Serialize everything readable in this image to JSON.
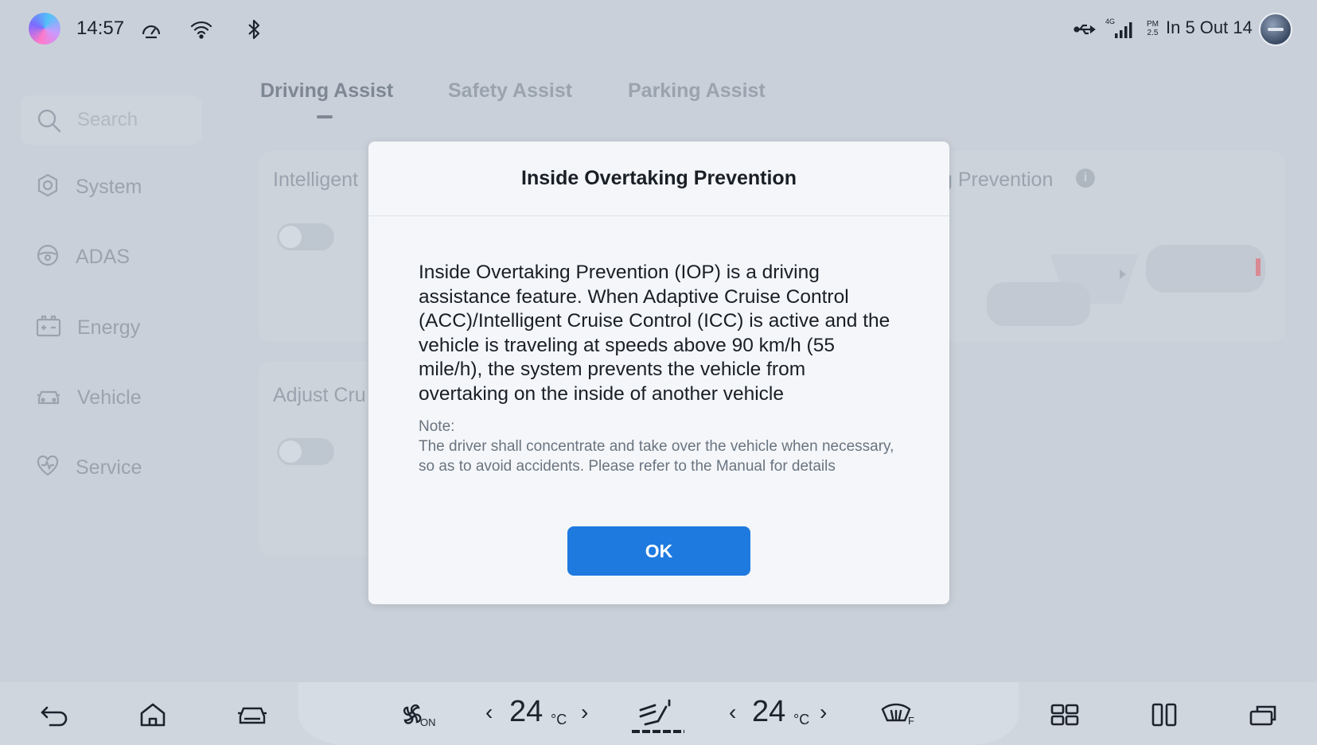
{
  "status_bar": {
    "time": "14:57",
    "traffic": "In 5 Out 14",
    "network": "4G",
    "pm_label": "PM",
    "pm_value": "2.5"
  },
  "tabs": [
    {
      "label": "Driving Assist",
      "active": true
    },
    {
      "label": "Safety Assist",
      "active": false
    },
    {
      "label": "Parking Assist",
      "active": false
    }
  ],
  "search": {
    "placeholder": "Search"
  },
  "sidebar": {
    "items": [
      {
        "label": "System",
        "icon": "gear-icon"
      },
      {
        "label": "ADAS",
        "icon": "steering-wheel-icon"
      },
      {
        "label": "Energy",
        "icon": "battery-icon"
      },
      {
        "label": "Vehicle",
        "icon": "car-icon"
      },
      {
        "label": "Service",
        "icon": "heart-pulse-icon"
      }
    ]
  },
  "cards": {
    "card1_title": "Intelligent",
    "card2_title": "Adjust Cru",
    "card3_title": "g Prevention"
  },
  "dialog": {
    "title": "Inside Overtaking Prevention",
    "body": "Inside Overtaking Prevention (IOP) is a driving assistance feature. When Adaptive Cruise Control (ACC)/Intelligent Cruise Control (ICC) is active and the vehicle is traveling at speeds above 90 km/h (55 mile/h), the system prevents the vehicle from overtaking on the inside of another vehicle",
    "note_label": "Note:",
    "note": "The driver shall concentrate and take over the vehicle when necessary, so as to avoid accidents. Please refer to the Manual for details",
    "ok_label": "OK"
  },
  "dock": {
    "fan_label": "ON",
    "left_temp": "24",
    "right_temp": "24",
    "temp_unit": "°C",
    "defrost_label": "F"
  },
  "colors": {
    "accent": "#1f7ae0",
    "background": "#c9d0d9",
    "dialog": "#f4f6f9"
  }
}
